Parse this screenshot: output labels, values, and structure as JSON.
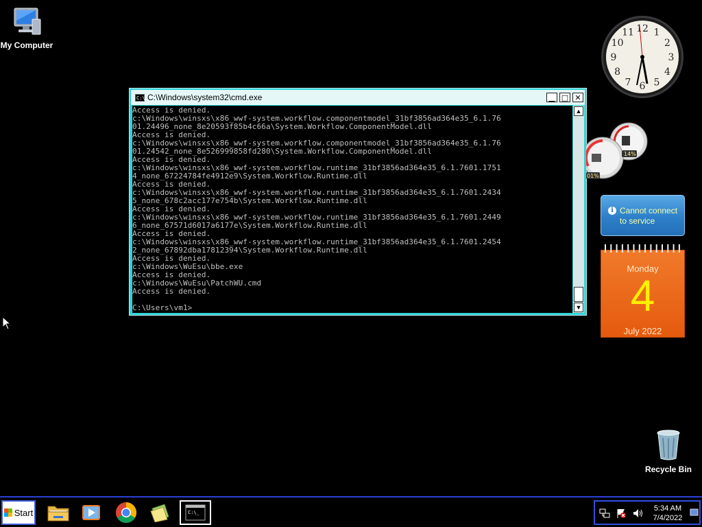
{
  "desktop": {
    "icons": [
      {
        "label": "My Computer"
      },
      {
        "label": "Recycle Bin"
      }
    ]
  },
  "cmd": {
    "title": "C:\\Windows\\system32\\cmd.exe",
    "lines": [
      "Access is denied.",
      "c:\\Windows\\winsxs\\x86_wwf-system.workflow.componentmodel_31bf3856ad364e35_6.1.76",
      "01.24496_none_8e20593f85b4c66a\\System.Workflow.ComponentModel.dll",
      "Access is denied.",
      "c:\\Windows\\winsxs\\x86_wwf-system.workflow.componentmodel_31bf3856ad364e35_6.1.76",
      "01.24542_none_8e526999858fd280\\System.Workflow.ComponentModel.dll",
      "Access is denied.",
      "c:\\Windows\\winsxs\\x86_wwf-system.workflow.runtime_31bf3856ad364e35_6.1.7601.1751",
      "4_none_67224784fe4912e9\\System.Workflow.Runtime.dll",
      "Access is denied.",
      "c:\\Windows\\winsxs\\x86_wwf-system.workflow.runtime_31bf3856ad364e35_6.1.7601.2434",
      "5_none_678c2acc177e754b\\System.Workflow.Runtime.dll",
      "Access is denied.",
      "c:\\Windows\\winsxs\\x86_wwf-system.workflow.runtime_31bf3856ad364e35_6.1.7601.2449",
      "6_none_67571d6017a6177e\\System.Workflow.Runtime.dll",
      "Access is denied.",
      "c:\\Windows\\winsxs\\x86_wwf-system.workflow.runtime_31bf3856ad364e35_6.1.7601.2454",
      "2_none_67892dba17812394\\System.Workflow.Runtime.dll",
      "Access is denied.",
      "c:\\Windows\\WuEsu\\bbe.exe",
      "Access is denied.",
      "c:\\Windows\\WuEsu\\PatchWU.cmd",
      "Access is denied.",
      "",
      "C:\\Users\\vm1>"
    ]
  },
  "gadgets": {
    "clock": {
      "numbers": [
        "12",
        "1",
        "2",
        "3",
        "4",
        "5",
        "6",
        "7",
        "8",
        "9",
        "10",
        "11"
      ]
    },
    "meter": {
      "cpu_label": "01%",
      "memory_label": "14%"
    },
    "weather": {
      "message_line1": "Cannot connect",
      "message_line2": "to service"
    },
    "calendar": {
      "day": "Monday",
      "date": "4",
      "month_year": "July 2022"
    }
  },
  "taskbar": {
    "start_label": "Start",
    "cmd_icon_text": "C:\\_",
    "time": "5:34 AM",
    "date": "7/4/2022"
  },
  "colors": {
    "cmd_frame": "#2fd3d8",
    "taskbar_accent": "#2a40d8",
    "calendar_orange": "#e8631a",
    "calendar_date": "#fff000"
  }
}
